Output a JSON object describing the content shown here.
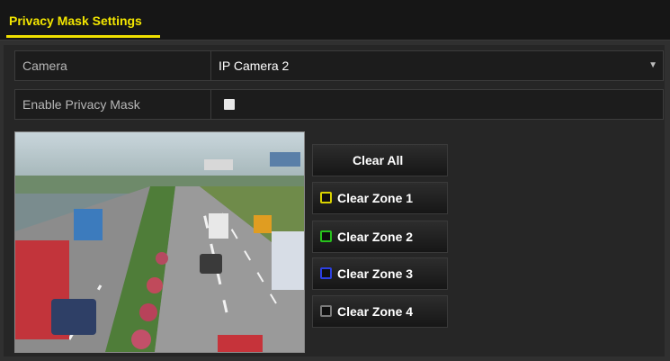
{
  "header": {
    "tab_label": "Privacy Mask Settings"
  },
  "form": {
    "camera_label": "Camera",
    "camera_value": "IP Camera 2",
    "enable_label": "Enable Privacy Mask",
    "enable_checked": false
  },
  "buttons": {
    "clear_all": "Clear All",
    "zones": [
      {
        "label": "Clear Zone 1",
        "color": "#d8d100"
      },
      {
        "label": "Clear Zone 2",
        "color": "#27c21c"
      },
      {
        "label": "Clear Zone 3",
        "color": "#2c3fe0"
      },
      {
        "label": "Clear Zone 4",
        "color": "#7a7a7a"
      }
    ]
  },
  "colors": {
    "accent": "#f0e000"
  }
}
